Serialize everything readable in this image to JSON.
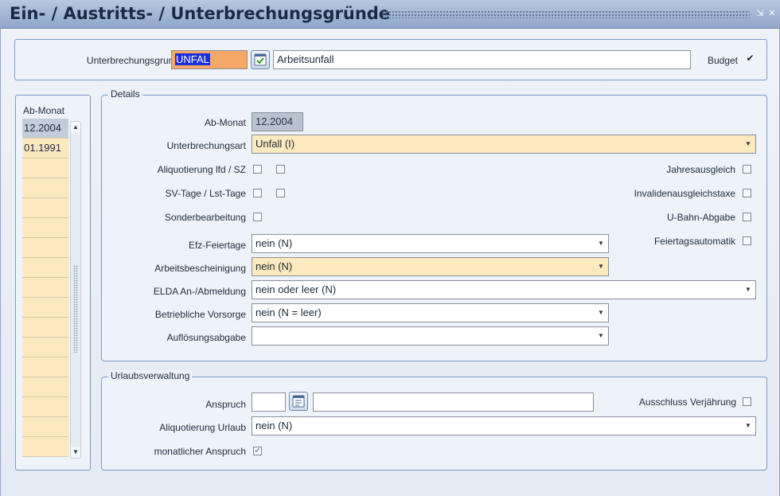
{
  "window": {
    "title": "Ein- / Austritts- / Unterbrechungsgründe",
    "minimize_icon": "minimize-icon",
    "close_icon": "close-icon"
  },
  "header": {
    "grund_label": "Unterbrechungsgrund",
    "grund_code": "UNFAL",
    "grund_text": "Arbeitsunfall",
    "validate_icon": "check-calendar-icon",
    "budget_label": "Budget",
    "budget_checked": "✔"
  },
  "list": {
    "header": "Ab-Monat",
    "items": [
      "12.2004",
      "01.1991"
    ],
    "up_icon": "▲",
    "down_icon": "▼"
  },
  "details": {
    "legend": "Details",
    "ab_monat_label": "Ab-Monat",
    "ab_monat_value": "12.2004",
    "unterbrechungsart_label": "Unterbrechungsart",
    "unterbrechungsart_value": "Unfall (I)",
    "aliquotierung_label": "Aliquotierung lfd / SZ",
    "sv_tage_label": "SV-Tage / Lst-Tage",
    "sonderbearbeitung_label": "Sonderbearbeitung",
    "jahresausgleich_label": "Jahresausgleich",
    "invalidenausgleichstaxe_label": "Invalidenausgleichstaxe",
    "ubahn_label": "U-Bahn-Abgabe",
    "feiertagsautomatik_label": "Feiertagsautomatik",
    "efz_label": "Efz-Feiertage",
    "efz_value": "nein (N)",
    "arbeitsbescheinigung_label": "Arbeitsbescheinigung",
    "arbeitsbescheinigung_value": "nein (N)",
    "elda_label": "ELDA An-/Abmeldung",
    "elda_value": "nein oder leer (N)",
    "vorsorge_label": "Betriebliche Vorsorge",
    "vorsorge_value": "nein (N = leer)",
    "aufloesung_label": "Auflösungsabgabe",
    "aufloesung_value": "",
    "dropdown_arrow": "▼"
  },
  "urlaub": {
    "legend": "Urlaubsverwaltung",
    "anspruch_label": "Anspruch",
    "anspruch_value": "",
    "anspruch_text": "",
    "calendar_icon": "calendar-icon",
    "ausschluss_label": "Ausschluss Verjährung",
    "aliquotierung_label": "Aliquotierung Urlaub",
    "aliquotierung_value": "nein (N)",
    "monatlich_label": "monatlicher Anspruch",
    "monatlich_checked": "✔"
  },
  "colors": {
    "titlebar": "#8fa7c9",
    "field_yellow": "#fde9c0",
    "field_orange": "#f5a866",
    "selection": "#1a2fd6",
    "border": "#7d9bc6"
  }
}
